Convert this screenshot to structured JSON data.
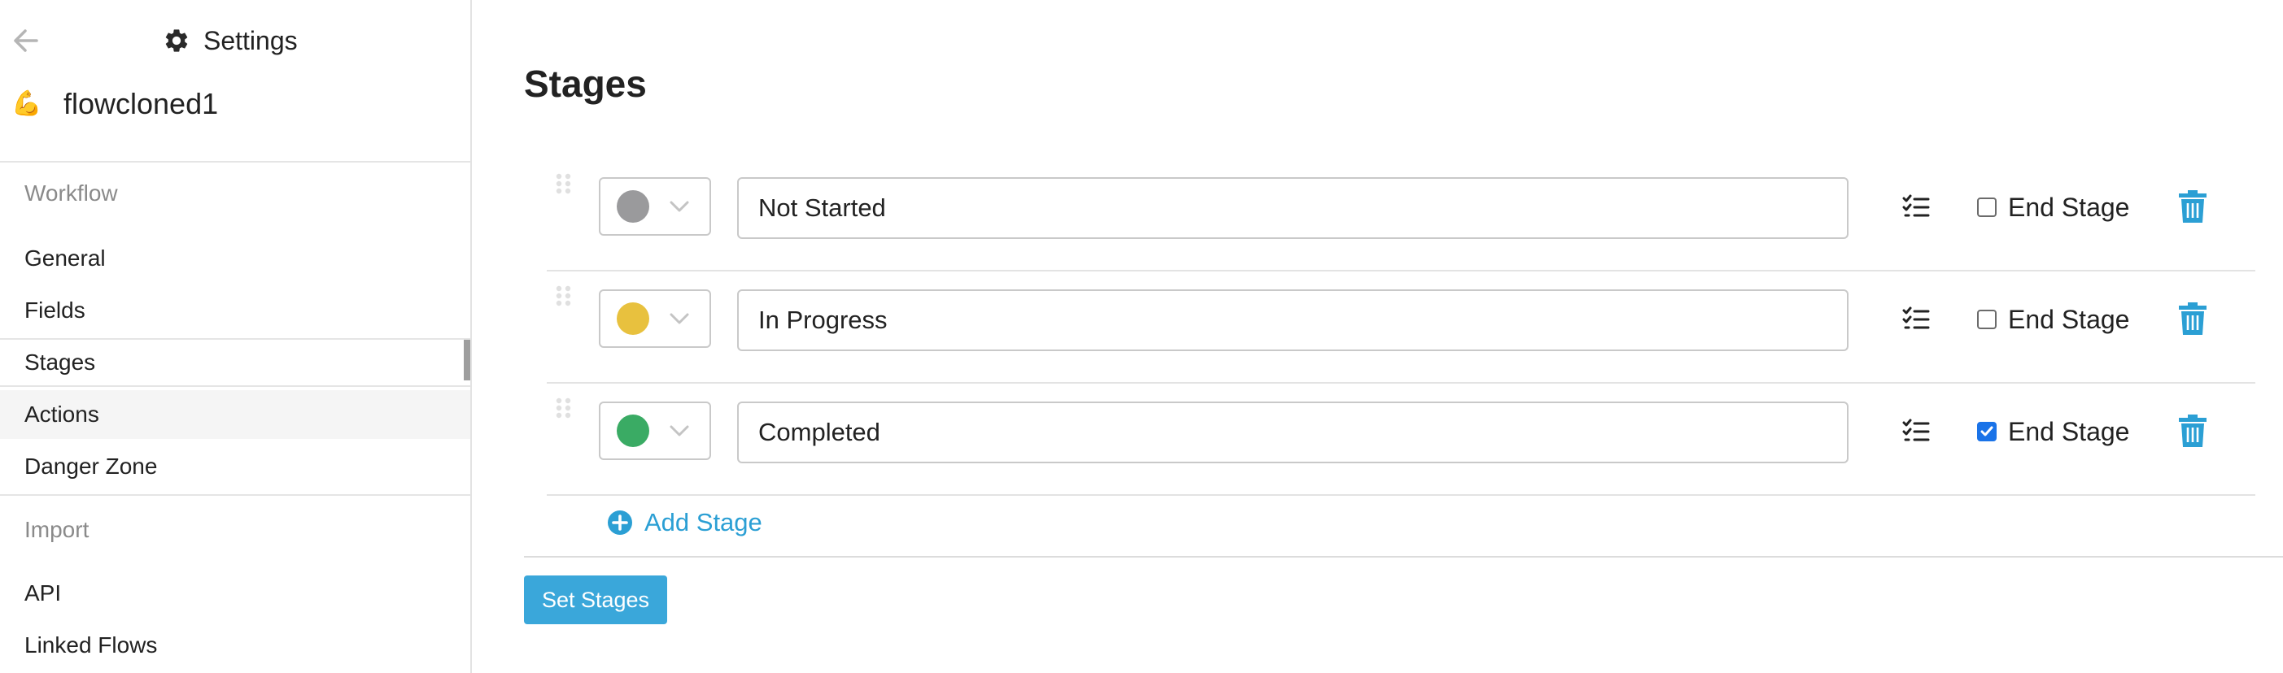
{
  "sidebar": {
    "header_title": "Settings",
    "flow_emoji": "💪",
    "flow_name": "flowcloned1",
    "workflow_section": "Workflow",
    "workflow_items": [
      "General",
      "Fields",
      "Stages",
      "Actions",
      "Danger Zone"
    ],
    "active_item": "Stages",
    "import_section": "Import",
    "import_items": [
      "API",
      "Linked Flows"
    ]
  },
  "main": {
    "title": "Stages",
    "end_stage_label": "End Stage",
    "stages": [
      {
        "name": "Not Started",
        "color": "#9a9a9c",
        "end_stage": false
      },
      {
        "name": "In Progress",
        "color": "#e8c13e",
        "end_stage": false
      },
      {
        "name": "Completed",
        "color": "#3aab64",
        "end_stage": true
      }
    ],
    "add_stage_label": "Add Stage",
    "submit_label": "Set Stages"
  },
  "colors": {
    "accent": "#2b9fd4",
    "button": "#3aa7da",
    "checkbox_checked": "#1a73e8"
  },
  "icons": {
    "back": "arrow-left-icon",
    "settings": "gear-icon",
    "drag": "drag-handle-icon",
    "chevron": "chevron-down-icon",
    "checklist": "checklist-icon",
    "trash": "trash-icon",
    "add": "plus-circle-icon"
  }
}
